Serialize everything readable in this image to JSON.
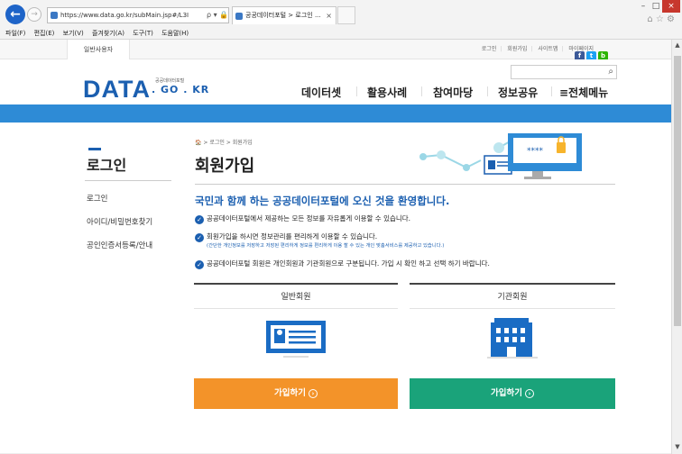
{
  "browser": {
    "address": "https://www.data.go.kr/subMain.jsp#/L3I",
    "address_icons": "ρ ▾ 🔒 C",
    "tab_title": "공공데이터포털 > 로그인 ...",
    "tab_close": "×",
    "back_icon": "←",
    "forward_icon": "→",
    "menu": [
      "파일(F)",
      "편집(E)",
      "보기(V)",
      "즐겨찾기(A)",
      "도구(T)",
      "도움말(H)"
    ],
    "window_buttons": [
      "–",
      "□",
      "×"
    ],
    "right_icons": "⌂ ☆ ⚙"
  },
  "site": {
    "top_tab": "일반사용자",
    "utils": [
      "로그인",
      "회원가입",
      "사이트맵",
      "마이페이지"
    ],
    "sns": [
      "f",
      "t",
      "b"
    ],
    "sns_colors": [
      "#3b5998",
      "#1da1f2",
      "#2db400"
    ],
    "logo": "DATA",
    "logo_sub": "공공데이터포털",
    "logo_domain": ". GO . KR",
    "search_icon": "🔍",
    "gnb": [
      "데이터셋",
      "활용사례",
      "참여마당",
      "정보공유",
      "≡전체메뉴"
    ],
    "accent": "#2e8bd6"
  },
  "lnb": {
    "title": "로그인",
    "items": [
      "로그인",
      "아이디/비밀번호찾기",
      "공인인증서등록/안내"
    ]
  },
  "main": {
    "breadcrumb": "🏠 > 로그인 > 회원가입",
    "title": "회원가입",
    "welcome": "국민과 함께 하는 공공데이터포털에 오신 것을 환영합니다.",
    "bullets": [
      "공공데이터포털에서 제공하는 모든 정보를 자유롭게 이용할 수 있습니다.",
      "회원가입을 하시면 정보관리를 편리하게 이용할 수 있습니다.",
      "공공데이터포털 회원은 개인회원과 기관회원으로 구분됩니다. 가입 시 확인 하고 선택 하기 바랍니다."
    ],
    "bullet_note": "(간단한 개인정보를 저장하고 저장된 편리하게 정보를 편리하게 이용 할 수 있는 개인 맞춤서비스를 제공하고 있습니다.)",
    "illustration_password": "****",
    "cards": [
      {
        "label": "일반회원",
        "button": "가입하기",
        "color": "#f39329",
        "icon": "id-card-icon"
      },
      {
        "label": "기관회원",
        "button": "가입하기",
        "color": "#1aa37a",
        "icon": "building-icon"
      }
    ]
  }
}
